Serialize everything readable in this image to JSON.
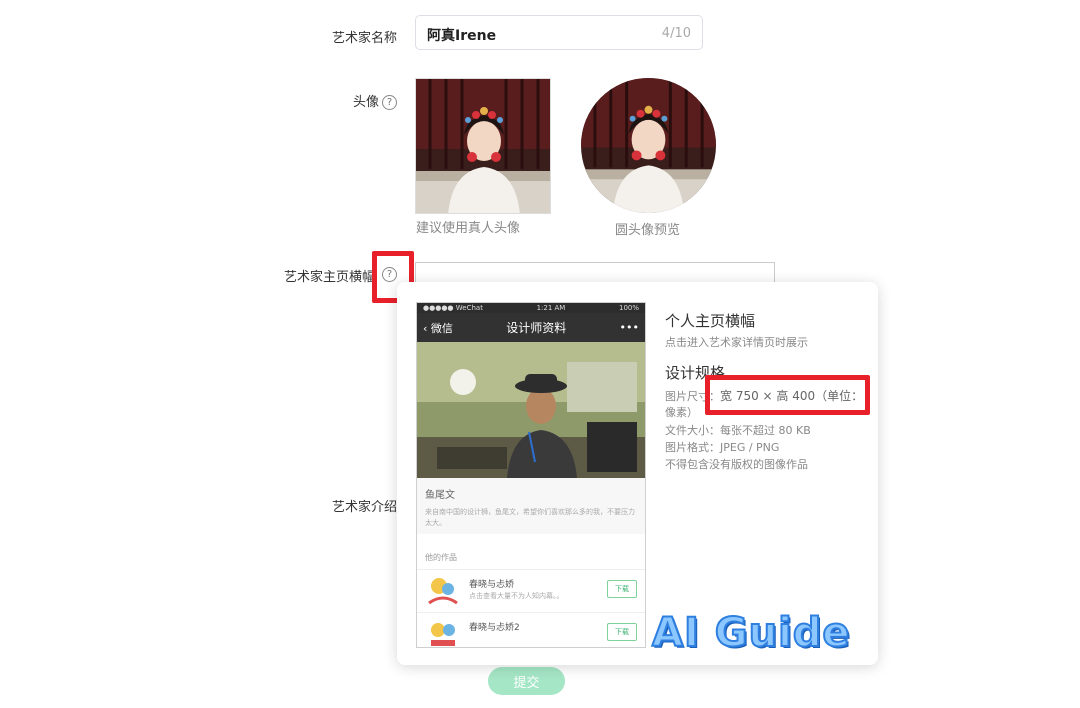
{
  "form": {
    "name_label": "艺术家名称",
    "name_value": "阿真Irene",
    "name_count": "4/10",
    "avatar_label": "头像",
    "avatar_hint": "建议使用真人头像",
    "avatar_preview_hint": "圆头像预览",
    "banner_label": "艺术家主页横幅",
    "intro_label": "艺术家介绍",
    "submit_label": "提交",
    "help_icon": "question-circle-icon"
  },
  "popover": {
    "phone": {
      "status_left": "●●●●● WeChat",
      "status_time": "1:21 AM",
      "status_right": "100%",
      "back_label": "微信",
      "title": "设计师资料",
      "more_label": "•••",
      "designer_name": "鱼尾文",
      "designer_desc": "来自南中国的设计狮，鱼尾文，希望你们喜欢那么多的我，不要压力太大。",
      "section_title": "他的作品",
      "works": [
        {
          "title": "春晓与忐娇",
          "desc": "点击查看大量不为人知内幕。。",
          "button": "下载"
        },
        {
          "title": "春晓与忐娇2",
          "desc": "",
          "button": "下载"
        }
      ]
    },
    "title": "个人主页横幅",
    "subtitle": "点击进入艺术家详情页时展示",
    "spec_heading": "设计规格",
    "size_label": "图片尺寸：",
    "size_value": "宽 750 × 高 400（单位：",
    "size_unit": "像素）",
    "file_size": "文件大小：每张不超过 80 KB",
    "file_format": "图片格式：JPEG / PNG",
    "copyright_note": "不得包含没有版权的图像作品"
  },
  "watermark": "AI Guide",
  "colors": {
    "highlight_red": "#e8202a",
    "submit_green": "#a5e6c6",
    "watermark_blue": "#2e7fe0"
  }
}
